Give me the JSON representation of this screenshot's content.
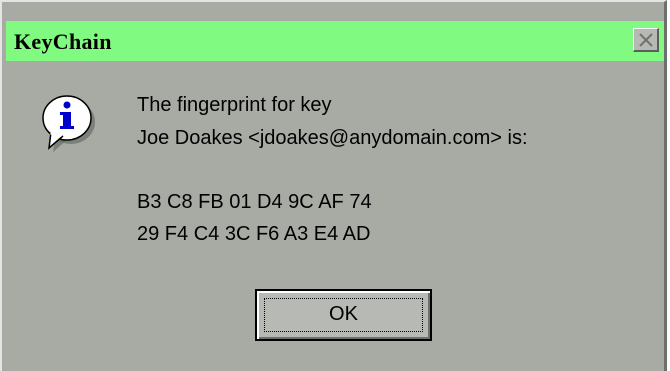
{
  "window": {
    "title": "KeyChain",
    "close_icon": "close-x-icon",
    "colors": {
      "titlebar": "#80fa80",
      "body": "#a7aba4",
      "button_face": "#b7bab4"
    }
  },
  "message": {
    "icon": "info-icon",
    "line1": "The fingerprint for key",
    "line2": "Joe Doakes <jdoakes@anydomain.com> is:",
    "fingerprint_line1": "B3 C8 FB 01 D4 9C AF 74",
    "fingerprint_line2": "29 F4 C4 3C F6 A3 E4 AD"
  },
  "buttons": {
    "ok_label": "OK"
  }
}
